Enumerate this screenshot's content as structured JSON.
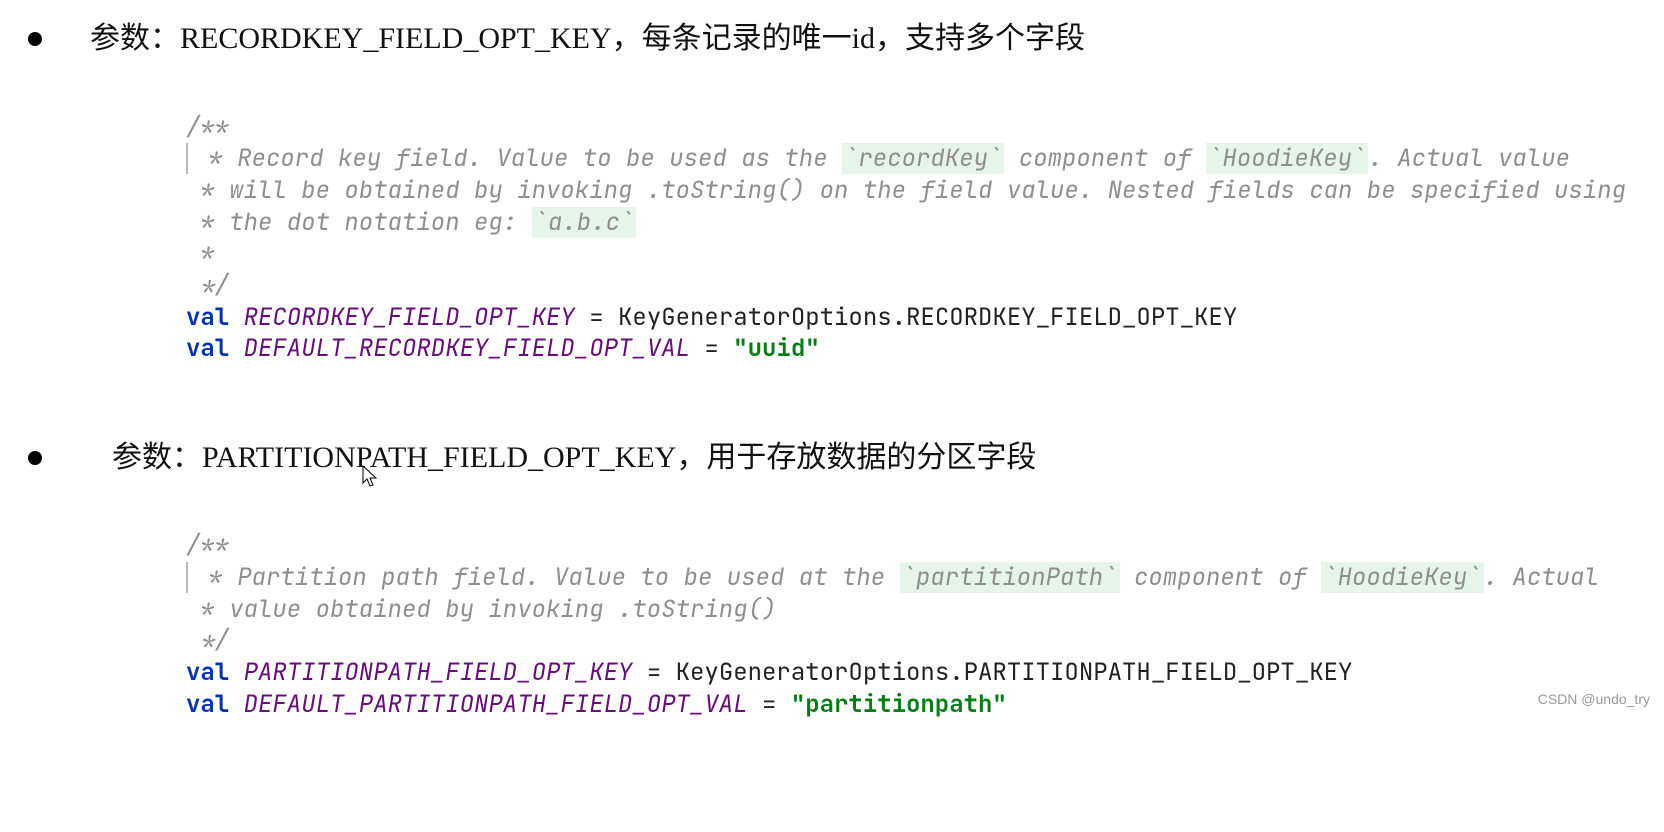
{
  "bullets": [
    {
      "label_prefix": "参数：",
      "param": "RECORDKEY_FIELD_OPT_KEY",
      "description": "，每条记录的唯一id，支持多个字段"
    },
    {
      "label_prefix": "参数：",
      "param": "PARTITIONPATH_FIELD_OPT_KEY",
      "description": "，用于存放数据的分区字段"
    }
  ],
  "code1": {
    "c_open": "/**",
    "c_l1_a": " * Record key field. Value to be used as the ",
    "c_l1_b": "`recordKey`",
    "c_l1_c": " component of ",
    "c_l1_d": "`HoodieKey`",
    "c_l1_e": ". Actual value",
    "c_l2": " * will be obtained by invoking .toString() on the field value. Nested fields can be specified using",
    "c_l3_a": " * the dot notation eg: ",
    "c_l3_b": "`a.b.c`",
    "c_l4": " *",
    "c_close": " */",
    "kw_val": "val",
    "const1": "RECORDKEY_FIELD_OPT_KEY",
    "eq": " = ",
    "rhs1": "KeyGeneratorOptions.RECORDKEY_FIELD_OPT_KEY",
    "const2": "DEFAULT_RECORDKEY_FIELD_OPT_VAL",
    "str2": "\"uuid\""
  },
  "code2": {
    "c_open": "/**",
    "c_l1_a": " * Partition path field. Value to be used at the ",
    "c_l1_b": "`partitionPath`",
    "c_l1_c": " component of ",
    "c_l1_d": "`HoodieKey`",
    "c_l1_e": ". Actual",
    "c_l2": " * value obtained by invoking .toString()",
    "c_close": " */",
    "kw_val": "val",
    "const1": "PARTITIONPATH_FIELD_OPT_KEY",
    "eq": " = ",
    "rhs1": "KeyGeneratorOptions.PARTITIONPATH_FIELD_OPT_KEY",
    "const2": "DEFAULT_PARTITIONPATH_FIELD_OPT_VAL",
    "str2": "\"partitionpath\""
  },
  "watermark": "CSDN @undo_try"
}
